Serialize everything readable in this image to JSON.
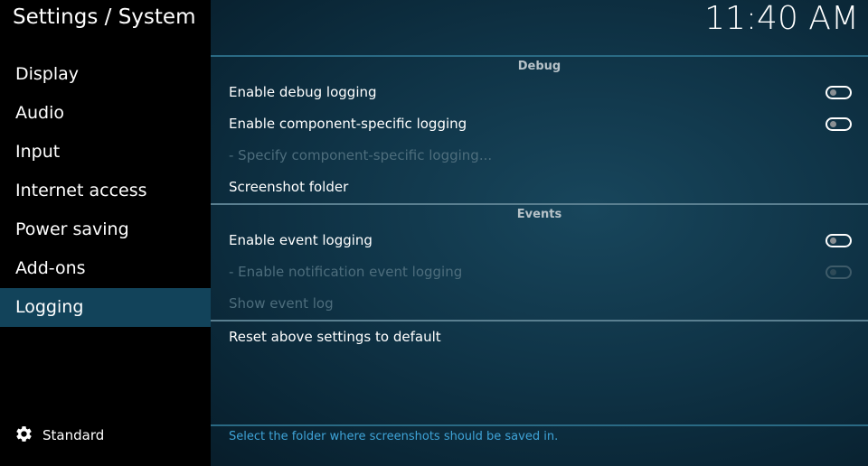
{
  "header": {
    "title": "Settings / System",
    "clock": "11:40 AM"
  },
  "sidebar": {
    "items": [
      {
        "label": "Display",
        "active": false
      },
      {
        "label": "Audio",
        "active": false
      },
      {
        "label": "Input",
        "active": false
      },
      {
        "label": "Internet access",
        "active": false
      },
      {
        "label": "Power saving",
        "active": false
      },
      {
        "label": "Add-ons",
        "active": false
      },
      {
        "label": "Logging",
        "active": true
      }
    ],
    "settings_level": {
      "icon": "gear-icon",
      "label": "Standard"
    }
  },
  "main": {
    "sections": [
      {
        "header": "Debug",
        "rows": [
          {
            "label": "Enable debug logging",
            "control": "toggle",
            "on": false,
            "enabled": true
          },
          {
            "label": "Enable component-specific logging",
            "control": "toggle",
            "on": false,
            "enabled": true
          },
          {
            "label": "- Specify component-specific logging...",
            "control": "none",
            "enabled": false
          },
          {
            "label": "Screenshot folder",
            "control": "none",
            "enabled": true
          }
        ]
      },
      {
        "header": "Events",
        "rows": [
          {
            "label": "Enable event logging",
            "control": "toggle",
            "on": false,
            "enabled": true
          },
          {
            "label": "- Enable notification event logging",
            "control": "toggle",
            "on": false,
            "enabled": false
          },
          {
            "label": "Show event log",
            "control": "none",
            "enabled": false
          }
        ]
      }
    ],
    "reset_label": "Reset above settings to default"
  },
  "footer": {
    "description": "Select the folder where screenshots should be saved in."
  },
  "colors": {
    "active_item_bg": "#12435a",
    "description_text": "#3fa4d8",
    "disabled_text": "#4d6d7c"
  }
}
